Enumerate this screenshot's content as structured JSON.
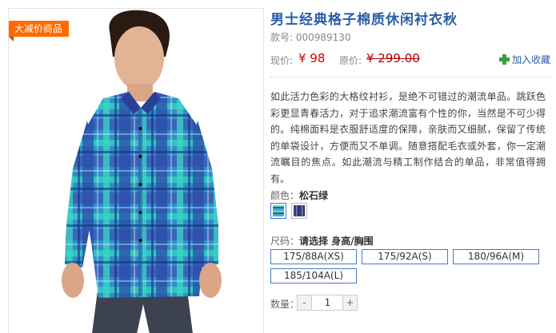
{
  "product": {
    "promo_badge": "大减价商品",
    "title": "男士经典格子棉质休闲衬衣秋",
    "sku": "款号: 000989130",
    "now_price_label": "现价:",
    "now_price": "¥ 98",
    "orig_price_label": "原价:",
    "orig_price": "¥ 299.00",
    "favorite_label": "加入收藏",
    "description": "如此活力色彩的大格纹衬衫，是绝不可错过的潮流单品。跳跃色彩更显青春活力，对于追求潮流富有个性的你，当然是不可少得的。纯棉面料是衣服舒适度的保障，亲肤而又细腻，保留了传统的单袋设计，方便而又不单调。随意搭配毛衣或外套，你一定潮流瞩目的焦点。如此潮流与精工制作结合的单品，非常值得拥有。"
  },
  "color": {
    "label": "颜色：",
    "selected": "松石绿",
    "swatches": [
      {
        "name": "松石绿",
        "color": "#3fb0c8"
      },
      {
        "name": "藏青",
        "color": "#3a3f7a"
      }
    ]
  },
  "size": {
    "label": "尺码：",
    "prompt": "请选择 身高/胸围",
    "options": [
      "175/88A(XS)",
      "175/92A(S)",
      "180/96A(M)",
      "185/104A(L)"
    ]
  },
  "quantity": {
    "label": "数量：",
    "minus": "-",
    "plus": "+",
    "value": "1"
  },
  "colors": {
    "title": "#2a5da8",
    "price": "#d40000",
    "badge": "#ff6a00",
    "size_border": "#4a79c4"
  }
}
